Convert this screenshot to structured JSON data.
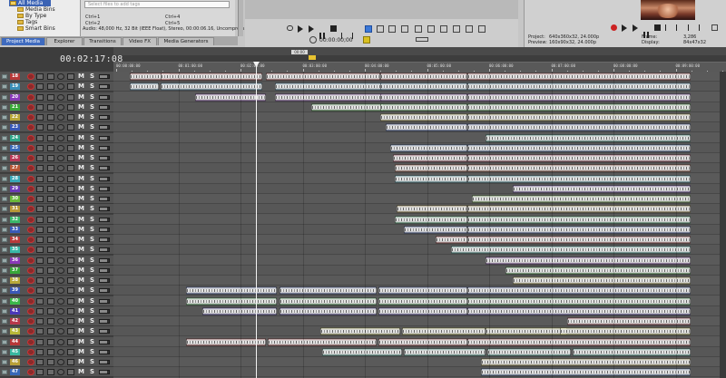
{
  "media_tree": {
    "items": [
      {
        "label": "All Media",
        "selected": true
      },
      {
        "label": "Media Bins",
        "selected": false
      },
      {
        "label": "By Type",
        "selected": false
      },
      {
        "label": "Tags",
        "selected": false
      },
      {
        "label": "Smart Bins",
        "selected": false
      }
    ]
  },
  "media_list": {
    "search_placeholder": "Select files to add tags",
    "shortcuts": [
      "Ctrl+1",
      "Ctrl+2",
      "Ctrl+4",
      "Ctrl+5"
    ],
    "audio_info": "Audio: 48,000 Hz, 32 Bit (IEEE Float), Stereo, 00:00:06.16, Uncompress"
  },
  "tabs": [
    {
      "label": "Project Media",
      "active": true
    },
    {
      "label": "Explorer",
      "active": false
    },
    {
      "label": "Transitions",
      "active": false
    },
    {
      "label": "Video FX",
      "active": false
    },
    {
      "label": "Media Generators",
      "active": false
    }
  ],
  "preview_toolbar": {
    "time": "00:00:00;00"
  },
  "video_preview": {
    "project": "Project:",
    "project_value": "640x360x32, 24.000p",
    "preview": "Preview:",
    "preview_value": "160x90x32, 24.000p",
    "frame_label": "Frame:",
    "frame_value": "3,286",
    "display_label": "Display:",
    "display_value": "84x47x32"
  },
  "timeline": {
    "timecode": "00:02:17:08",
    "marker_label": "00:00",
    "ruler": [
      "00:00:00:00",
      "00:01:00:00",
      "00:02:00:00",
      "00:03:00:00",
      "00:04:00:00",
      "00:05:00:00",
      "00:06:00:00",
      "00:07:00:00",
      "00:08:00:00",
      "00:09:00:00"
    ],
    "track_buttons": {
      "mute": "M",
      "solo": "S"
    },
    "tracks": [
      {
        "num": "18",
        "color": "#b83838"
      },
      {
        "num": "19",
        "color": "#3a8fb8"
      },
      {
        "num": "20",
        "color": "#8a3ab8"
      },
      {
        "num": "21",
        "color": "#3aa838"
      },
      {
        "num": "22",
        "color": "#b8a838"
      },
      {
        "num": "23",
        "color": "#3858b8"
      },
      {
        "num": "24",
        "color": "#2fa68a"
      },
      {
        "num": "25",
        "color": "#3a6ab8"
      },
      {
        "num": "26",
        "color": "#b83858"
      },
      {
        "num": "27",
        "color": "#b85838"
      },
      {
        "num": "28",
        "color": "#38a8b8"
      },
      {
        "num": "29",
        "color": "#6a3ab8"
      },
      {
        "num": "30",
        "color": "#6ab83a"
      },
      {
        "num": "31",
        "color": "#b89838"
      },
      {
        "num": "32",
        "color": "#3ab86a"
      },
      {
        "num": "33",
        "color": "#385ab8"
      },
      {
        "num": "34",
        "color": "#b83a3a"
      },
      {
        "num": "35",
        "color": "#38b8a8"
      },
      {
        "num": "36",
        "color": "#8a38b8"
      },
      {
        "num": "37",
        "color": "#38a838"
      },
      {
        "num": "38",
        "color": "#b8a838"
      },
      {
        "num": "39",
        "color": "#3a58b8"
      },
      {
        "num": "40",
        "color": "#3ab84a"
      },
      {
        "num": "41",
        "color": "#4a38b8"
      },
      {
        "num": "42",
        "color": "#b8384a"
      },
      {
        "num": "43",
        "color": "#b8b838"
      },
      {
        "num": "44",
        "color": "#b83838"
      },
      {
        "num": "45",
        "color": "#38b8a0"
      },
      {
        "num": "46",
        "color": "#b8a038"
      },
      {
        "num": "47",
        "color": "#3868b8"
      }
    ]
  }
}
